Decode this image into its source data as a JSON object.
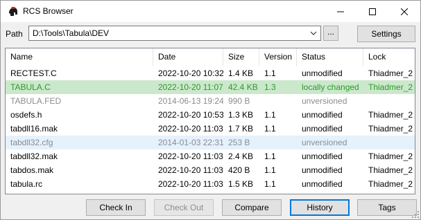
{
  "window": {
    "title": "RCS Browser"
  },
  "path": {
    "label": "Path",
    "value": "D:\\Tools\\Tabula\\DEV",
    "browse_label": "..."
  },
  "toolbar": {
    "settings_label": "Settings"
  },
  "table": {
    "columns": [
      "Name",
      "Date",
      "Size",
      "Version",
      "Status",
      "Lock"
    ],
    "rows": [
      {
        "name": "RECTEST.C",
        "date": "2022-10-20 10:32",
        "size": "1.4 KB",
        "version": "1.1",
        "status": "unmodified",
        "lock": "Thiadmer_2",
        "state": "normal"
      },
      {
        "name": "TABULA.C",
        "date": "2022-10-20 11:07",
        "size": "42.4 KB",
        "version": "1.3",
        "status": "locally changed",
        "lock": "Thiadmer_2",
        "state": "changed-selected"
      },
      {
        "name": "TABULA.FED",
        "date": "2014-06-13 19:24",
        "size": "990 B",
        "version": "",
        "status": "unversioned",
        "lock": "",
        "state": "unversioned"
      },
      {
        "name": "osdefs.h",
        "date": "2022-10-20 10:53",
        "size": "1.3 KB",
        "version": "1.1",
        "status": "unmodified",
        "lock": "Thiadmer_2",
        "state": "normal"
      },
      {
        "name": "tabdll16.mak",
        "date": "2022-10-20 11:03",
        "size": "1.7 KB",
        "version": "1.1",
        "status": "unmodified",
        "lock": "Thiadmer_2",
        "state": "normal"
      },
      {
        "name": "tabdll32.cfg",
        "date": "2014-01-03 22:31",
        "size": "253 B",
        "version": "",
        "status": "unversioned",
        "lock": "",
        "state": "unversioned-hover"
      },
      {
        "name": "tabdll32.mak",
        "date": "2022-10-20 11:03",
        "size": "2.4 KB",
        "version": "1.1",
        "status": "unmodified",
        "lock": "Thiadmer_2",
        "state": "normal"
      },
      {
        "name": "tabdos.mak",
        "date": "2022-10-20 11:03",
        "size": "420 B",
        "version": "1.1",
        "status": "unmodified",
        "lock": "Thiadmer_2",
        "state": "normal"
      },
      {
        "name": "tabula.rc",
        "date": "2022-10-20 11:03",
        "size": "1.5 KB",
        "version": "1.1",
        "status": "unmodified",
        "lock": "Thiadmer_2",
        "state": "normal"
      }
    ]
  },
  "actions": {
    "checkin": "Check In",
    "checkout": "Check Out",
    "compare": "Compare",
    "history": "History",
    "tags": "Tags"
  },
  "colors": {
    "changed_text": "#2b9a2b",
    "selected_row": "#cce8cc",
    "hover_row": "#e5f1fb",
    "unversioned_text": "#8c8c8c",
    "focus_border": "#0078d7"
  },
  "icons": [
    "app-helmet-icon",
    "minimize-icon",
    "maximize-icon",
    "close-icon",
    "chevron-down-icon",
    "resize-grip-icon"
  ]
}
